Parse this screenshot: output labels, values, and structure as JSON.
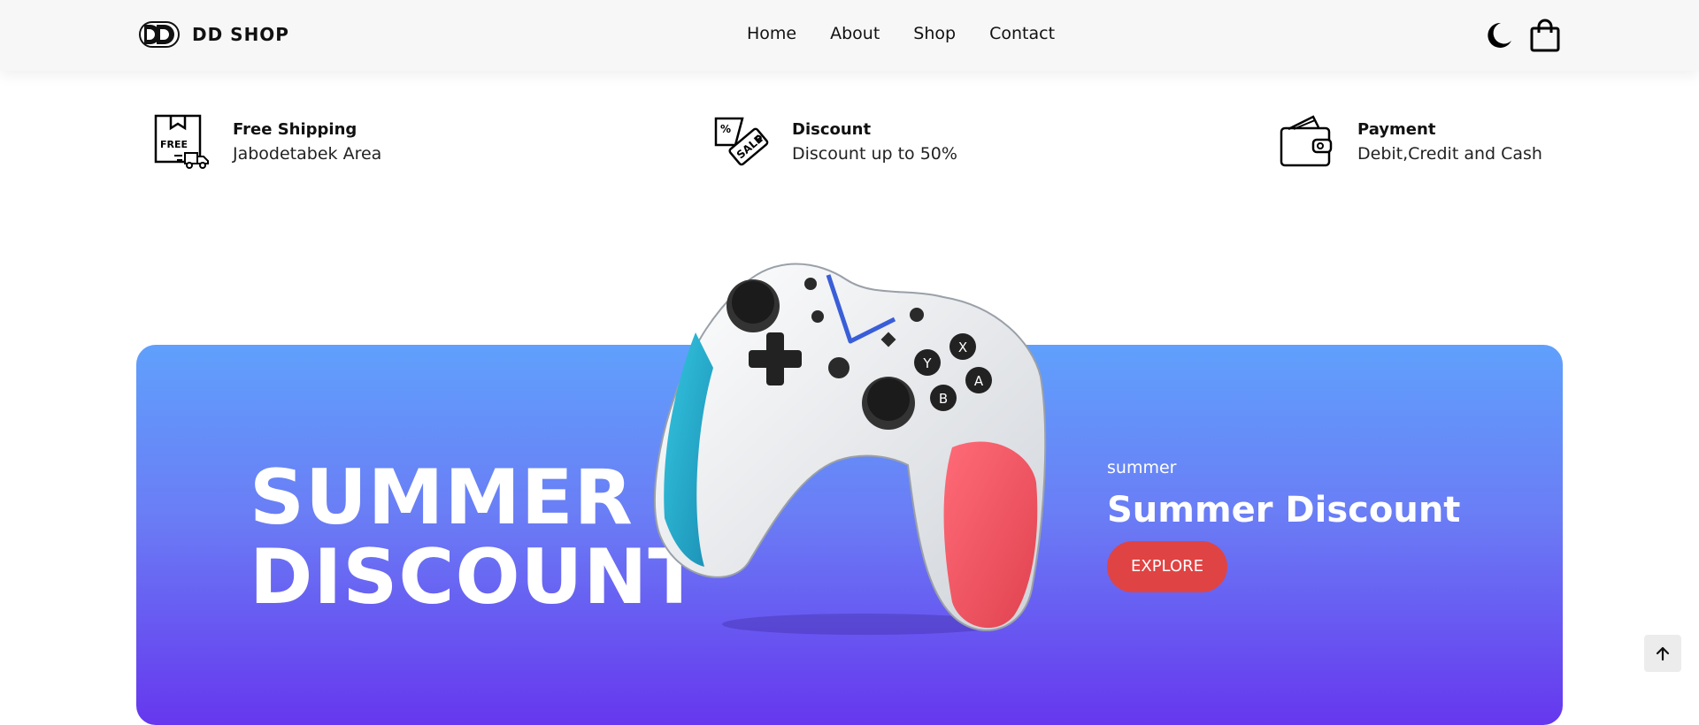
{
  "brand": {
    "name": "DD SHOP"
  },
  "nav": {
    "items": [
      {
        "label": "Home"
      },
      {
        "label": "About"
      },
      {
        "label": "Shop"
      },
      {
        "label": "Contact"
      }
    ]
  },
  "header_icons": [
    "moon-icon",
    "shopping-bag-icon"
  ],
  "features": [
    {
      "icon": "free-shipping-icon",
      "icon_text": "FREE",
      "title": "Free Shipping",
      "desc": "Jabodetabek Area"
    },
    {
      "icon": "sale-tag-icon",
      "icon_text": "SALE",
      "title": "Discount",
      "desc": "Discount up to 50%"
    },
    {
      "icon": "wallet-icon",
      "title": "Payment",
      "desc": "Debit,Credit and Cash"
    }
  ],
  "banner": {
    "headline_line1": "SUMMER",
    "headline_line2": "DISCOUNT",
    "small_label": "summer",
    "promo_title": "Summer Discount",
    "cta_label": "EXPLORE",
    "image": "game-controller",
    "controller_buttons": [
      "Y",
      "X",
      "B",
      "A"
    ]
  },
  "colors": {
    "banner_top": "#60a0fc",
    "banner_bottom": "#6637ee",
    "cta": "#e04343",
    "header_bg": "#f7f7f7"
  },
  "scroll_top_icon": "arrow-up-icon"
}
